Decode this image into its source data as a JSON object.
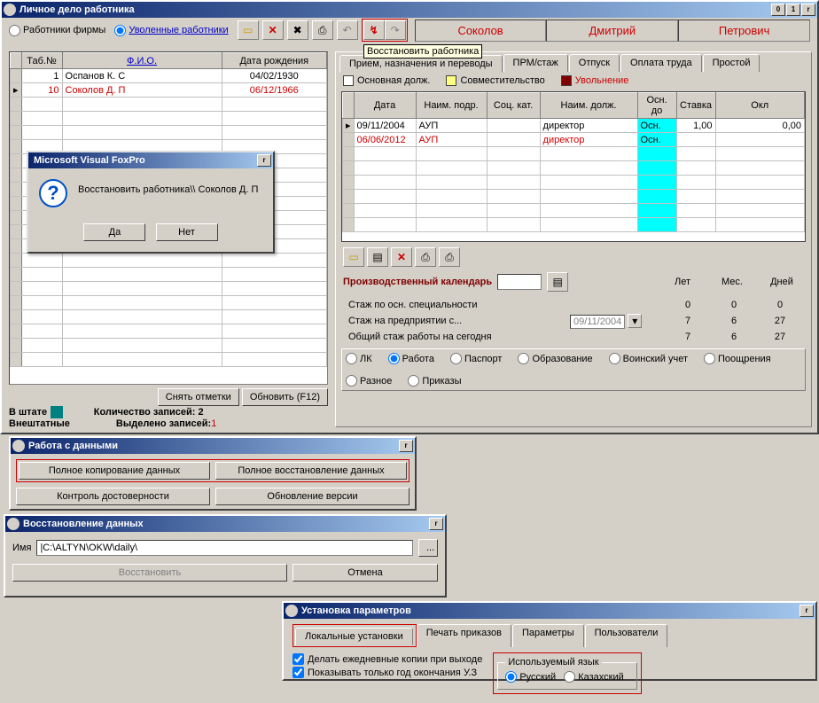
{
  "main": {
    "title": "Личное дело работника",
    "radios": {
      "firm": "Работники фирмы",
      "fired": "Уволенные работники"
    },
    "tooltip": "Восстановить работника",
    "names": {
      "last": "Соколов",
      "first": "Дмитрий",
      "patr": "Петрович"
    },
    "grid": {
      "headers": {
        "tabno": "Таб.№",
        "fio": "Ф.И.О.",
        "dob": "Дата рождения"
      },
      "rows": [
        {
          "tab": "1",
          "fio": "Оспанов К. С",
          "dob": "04/02/1930"
        },
        {
          "tab": "10",
          "fio": "Соколов Д. П",
          "dob": "06/12/1966"
        }
      ]
    },
    "btns": {
      "unmark": "Снять отметки",
      "refresh": "Обновить (F12)"
    },
    "status": {
      "l1a": "В штате",
      "l1b": "Количество записей:",
      "l1v": "2",
      "l2a": "Внештатные",
      "l2b": "Выделено записей:",
      "l2v": "1"
    }
  },
  "right": {
    "tabs": [
      "Прием, назначения и переводы",
      "ПРМ/стаж",
      "Отпуск",
      "Оплата труда",
      "Простой"
    ],
    "legend": {
      "main": "Основная долж.",
      "combo": "Совместительство",
      "fire": "Увольнение"
    },
    "grid": {
      "headers": [
        "Дата",
        "Наим. подр.",
        "Соц. кат.",
        "Наим. долж.",
        "Осн. до",
        "Ставка",
        "Окл"
      ],
      "rows": [
        {
          "date": "09/11/2004",
          "dept": "АУП",
          "soc": "",
          "pos": "директор",
          "osn": "Осн.",
          "rate": "1,00",
          "sal": "0,00"
        },
        {
          "date": "06/06/2012",
          "dept": "АУП",
          "soc": "",
          "pos": "директор",
          "osn": "Осн.",
          "rate": "",
          "sal": ""
        }
      ]
    },
    "cal": {
      "label": "Производственный календарь",
      "head_y": "Лет",
      "head_m": "Мес.",
      "head_d": "Дней"
    },
    "stats": [
      {
        "label": "Стаж по осн. специальности",
        "y": "0",
        "m": "0",
        "d": "0"
      },
      {
        "label": "Стаж на предприятии с...",
        "date": "09/11/2004",
        "y": "7",
        "m": "6",
        "d": "27"
      },
      {
        "label": "Общий стаж работы на сегодня",
        "y": "7",
        "m": "6",
        "d": "27"
      }
    ],
    "radios2": [
      "ЛК",
      "Работа",
      "Паспорт",
      "Образование",
      "Воинский учет",
      "Поощрения",
      "Разное",
      "Приказы"
    ]
  },
  "dlg": {
    "title": "Microsoft Visual FoxPro",
    "msg": "Восстановить работника\\\\ Соколов Д. П",
    "yes": "Да",
    "no": "Нет"
  },
  "win2": {
    "title": "Работа с данными",
    "b1": "Полное копирование данных",
    "b2": "Полное восстановление данных",
    "b3": "Контроль достоверности",
    "b4": "Обновление версии"
  },
  "win3": {
    "title": "Восстановление данных",
    "lbl": "Имя",
    "path": "|C:\\ALTYN\\OKW\\daily\\",
    "restore": "Восстановить",
    "cancel": "Отмена"
  },
  "win4": {
    "title": "Установка параметров",
    "tabs": [
      "Локальные установки",
      "Печать приказов",
      "Параметры",
      "Пользователи"
    ],
    "chk1": "Делать ежедневные копии при выходе",
    "chk2": "Показывать только год окончания У.З",
    "langlbl": "Используемый язык",
    "ru": "Русский",
    "kz": "Казахский"
  }
}
